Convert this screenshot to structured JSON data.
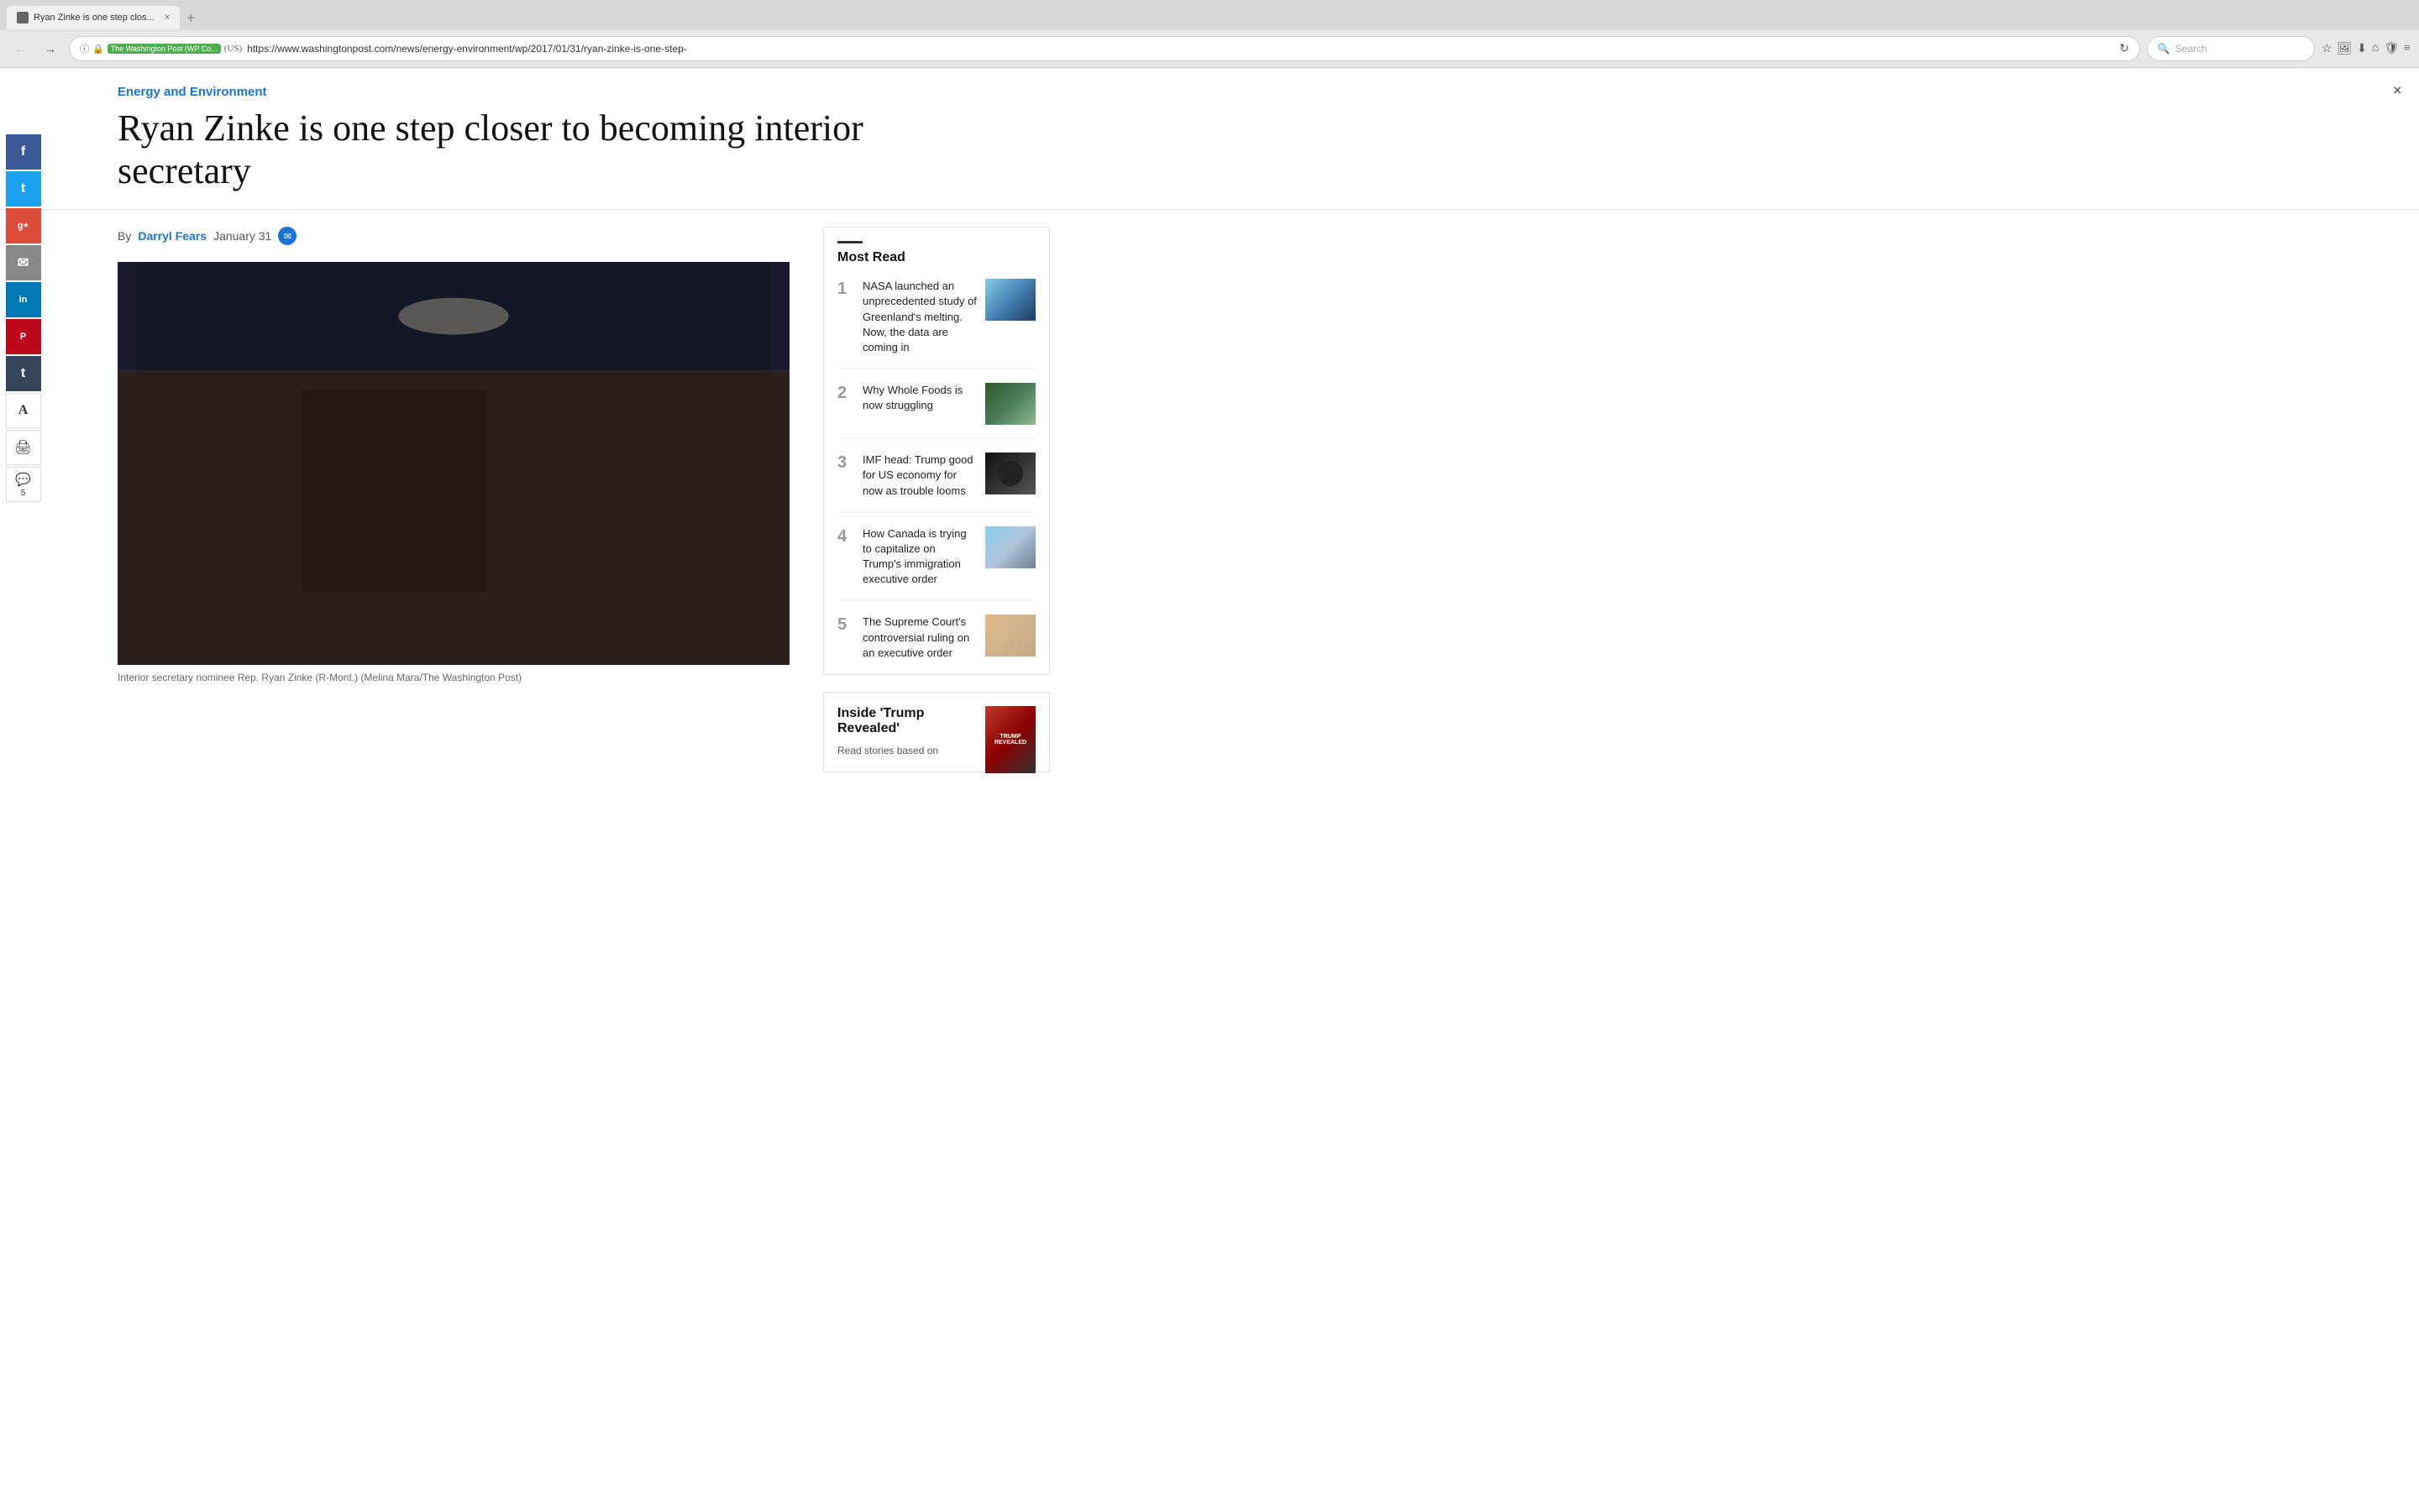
{
  "browser": {
    "tab_title": "Ryan Zinke is one step clos...",
    "tab_new_label": "+",
    "back_btn": "←",
    "forward_btn": "→",
    "info_icon": "ⓘ",
    "lock_icon": "🔒",
    "site_name": "The Washington Post (WP Co...",
    "region": "(US)",
    "url": "https://www.washingtonpost.com/news/energy-environment/wp/2017/01/31/ryan-zinke-is-one-step-",
    "reload_icon": "↻",
    "search_placeholder": "Search",
    "bookmark_icon": "☆",
    "screenshot_icon": "🖼",
    "download_icon": "⬇",
    "home_icon": "⌂",
    "shield_icon": "🛡",
    "menu_icon": "≡"
  },
  "article": {
    "close_btn": "×",
    "category": "Energy and Environment",
    "title": "Ryan Zinke is one step closer to becoming interior secretary",
    "byline_prefix": "By",
    "author": "Darryl Fears",
    "date": "January 31",
    "email_icon": "✉",
    "image_caption": "Interior secretary nominee Rep. Ryan Zinke (R-Mont.) (Melina Mara/The Washington Post)"
  },
  "social": {
    "facebook": "f",
    "twitter": "t",
    "googleplus": "g+",
    "email": "✉",
    "linkedin": "in",
    "pinterest": "P",
    "tumblr": "t",
    "font": "A",
    "print": "🖨",
    "comment_icon": "💬",
    "comment_count": "5"
  },
  "most_read": {
    "section_bar": "",
    "title": "Most Read",
    "items": [
      {
        "number": "1",
        "text": "NASA launched an unprecedented study of Greenland's melting. Now, the data are coming in",
        "thumb_type": "nasa"
      },
      {
        "number": "2",
        "text": "Why Whole Foods is now struggling",
        "thumb_type": "wholefoods"
      },
      {
        "number": "3",
        "text": "IMF head: Trump good for US economy for now as trouble looms",
        "thumb_type": "imf"
      },
      {
        "number": "4",
        "text": "How Canada is trying to capitalize on Trump's immigration executive order",
        "thumb_type": "canada"
      },
      {
        "number": "5",
        "text": "The Supreme Court's controversial ruling on an executive order",
        "thumb_type": "court"
      }
    ]
  },
  "trump_revealed": {
    "title": "Inside 'Trump Revealed'",
    "subtitle": "Read stories based on",
    "book_line1": "TRUMP",
    "book_line2": "REVEALED"
  }
}
